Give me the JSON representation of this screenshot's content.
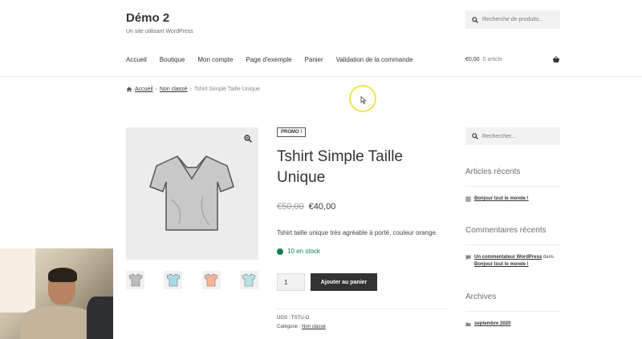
{
  "site": {
    "title": "Démo 2",
    "description": "Un site utilisant WordPress"
  },
  "header_search": {
    "placeholder": "Recherche de produits..."
  },
  "nav": {
    "items": [
      "Accueil",
      "Boutique",
      "Mon compte",
      "Page d'exemple",
      "Panier",
      "Validation de la commande"
    ]
  },
  "cart": {
    "amount": "€0,00",
    "count": "0 article"
  },
  "breadcrumb": {
    "home": "Accueil",
    "category": "Non classé",
    "separator": "›",
    "current": "Tshirt Simple Taille Unique"
  },
  "product": {
    "badge": "PROMO !",
    "title": "Tshirt Simple Taille Unique",
    "old_price": "€50,00",
    "new_price": "€40,00",
    "description": "Tshirt taille unique très agréable à porté, couleur orange.",
    "stock": "10 en stock",
    "quantity": "1",
    "add_to_cart": "Ajouter au panier",
    "sku_label": "UGS : ",
    "sku": "TSTU-O",
    "category_label": "Catégorie : ",
    "category": "Non classé",
    "thumb_colors": [
      "#bdbdbd",
      "#a9d9e6",
      "#f6b49a",
      "#b8e3e3"
    ]
  },
  "sidebar": {
    "search_placeholder": "Rechercher...",
    "recent_posts_title": "Articles récents",
    "recent_post": "Bonjour tout le monde !",
    "recent_comments_title": "Commentaires récents",
    "comment_author": "Un commentateur WordPress",
    "comment_on": " dans ",
    "comment_post": "Bonjour tout le monde !",
    "archives_title": "Archives",
    "archive_item": "septembre 2020"
  },
  "colors": {
    "accent_green": "#0f834d",
    "button_dark": "#333333",
    "cursor_ring": "#f2e44a"
  }
}
